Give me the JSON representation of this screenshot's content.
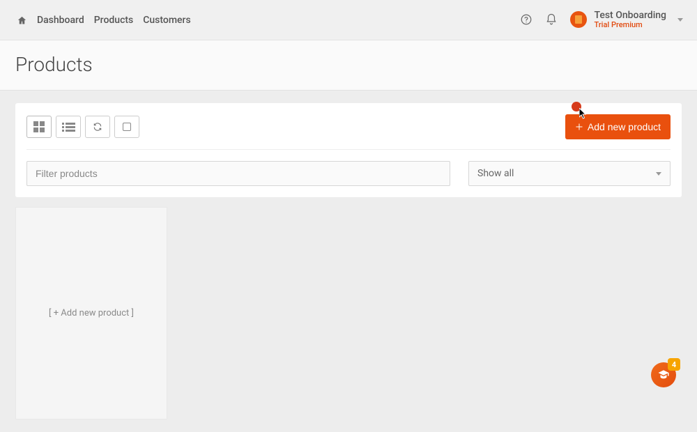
{
  "nav": {
    "dashboard": "Dashboard",
    "products": "Products",
    "customers": "Customers"
  },
  "account": {
    "name": "Test Onboarding",
    "tier": "Trial Premium"
  },
  "page": {
    "title": "Products"
  },
  "toolbar": {
    "add_label": "Add new product"
  },
  "filter": {
    "placeholder": "Filter products"
  },
  "filter_select": {
    "selected": "Show all"
  },
  "tile": {
    "add_label": "[ + Add new product ]"
  },
  "help_fab": {
    "badge": "4"
  }
}
